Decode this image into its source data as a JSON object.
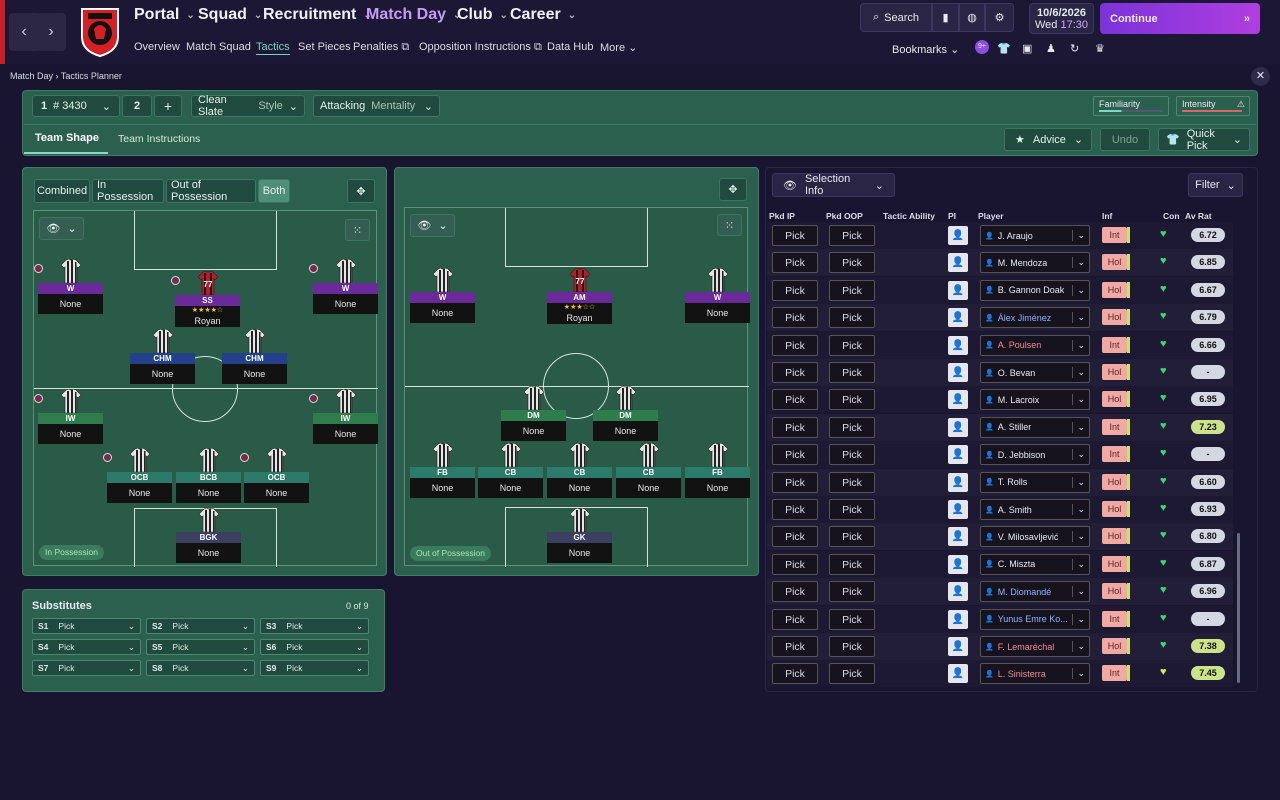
{
  "nav": {
    "main": [
      "Portal",
      "Squad",
      "Recruitment",
      "Match Day",
      "Club",
      "Career"
    ],
    "sub": [
      "Overview",
      "Match Squad",
      "Tactics",
      "Set Pieces",
      "Penalties",
      "Opposition Instructions",
      "Data Hub",
      "More"
    ],
    "search": "Search",
    "date": "10/6/2026",
    "day": "Wed",
    "time": "17:30",
    "continue": "Continue",
    "bookmarks": "Bookmarks",
    "badge": "9+"
  },
  "breadcrumb": {
    "a": "Match Day",
    "b": "Tactics Planner"
  },
  "tactics": {
    "slot1": "1",
    "formation": "# 3430",
    "slot2": "2",
    "style_name": "Clean Slate",
    "style_label": "Style",
    "mentality_name": "Attacking",
    "mentality_label": "Mentality",
    "familiarity": "Familiarity",
    "intensity": "Intensity",
    "tab_shape": "Team Shape",
    "tab_instr": "Team Instructions",
    "advice": "Advice",
    "undo": "Undo",
    "quick_pick": "Quick Pick",
    "view_btns": [
      "Combined",
      "In Possession",
      "Out of Possession",
      "Both"
    ],
    "in_pos": "In Possession",
    "out_pos": "Out of Possession"
  },
  "ip_slots": [
    {
      "pos": "W",
      "name": "None",
      "c": "purple"
    },
    {
      "pos": "SS",
      "name": "Royan",
      "c": "purple",
      "num": "77",
      "stars": "★★★★☆"
    },
    {
      "pos": "W",
      "name": "None",
      "c": "purple"
    },
    {
      "pos": "CHM",
      "name": "None",
      "c": "blue"
    },
    {
      "pos": "CHM",
      "name": "None",
      "c": "blue"
    },
    {
      "pos": "IW",
      "name": "None",
      "c": "green"
    },
    {
      "pos": "IW",
      "name": "None",
      "c": "green"
    },
    {
      "pos": "OCB",
      "name": "None",
      "c": "teal"
    },
    {
      "pos": "BCB",
      "name": "None",
      "c": "teal"
    },
    {
      "pos": "OCB",
      "name": "None",
      "c": "teal"
    },
    {
      "pos": "BGK",
      "name": "None",
      "c": "grey"
    }
  ],
  "op_slots": [
    {
      "pos": "W",
      "name": "None",
      "c": "purple"
    },
    {
      "pos": "AM",
      "name": "Royan",
      "c": "purple",
      "num": "77",
      "stars": "★★★☆☆"
    },
    {
      "pos": "W",
      "name": "None",
      "c": "purple"
    },
    {
      "pos": "DM",
      "name": "None",
      "c": "green"
    },
    {
      "pos": "DM",
      "name": "None",
      "c": "green"
    },
    {
      "pos": "FB",
      "name": "None",
      "c": "teal"
    },
    {
      "pos": "CB",
      "name": "None",
      "c": "teal"
    },
    {
      "pos": "CB",
      "name": "None",
      "c": "teal"
    },
    {
      "pos": "CB",
      "name": "None",
      "c": "teal"
    },
    {
      "pos": "FB",
      "name": "None",
      "c": "teal"
    },
    {
      "pos": "GK",
      "name": "None",
      "c": "grey"
    }
  ],
  "subs": {
    "title": "Substitutes",
    "count": "0 of 9",
    "items": [
      {
        "s": "S1",
        "v": "Pick"
      },
      {
        "s": "S2",
        "v": "Pick"
      },
      {
        "s": "S3",
        "v": "Pick"
      },
      {
        "s": "S4",
        "v": "Pick"
      },
      {
        "s": "S5",
        "v": "Pick"
      },
      {
        "s": "S6",
        "v": "Pick"
      },
      {
        "s": "S7",
        "v": "Pick"
      },
      {
        "s": "S8",
        "v": "Pick"
      },
      {
        "s": "S9",
        "v": "Pick"
      }
    ]
  },
  "selection": {
    "info": "Selection Info",
    "filter": "Filter",
    "headers": [
      "Pkd IP",
      "Pkd OOP",
      "Tactic Ability",
      "PI",
      "Player",
      "Inf",
      "Con",
      "Av Rat"
    ],
    "pick": "Pick",
    "rows": [
      {
        "p": "J. Araujo",
        "inf": "Int",
        "rat": "6.72",
        "col": "#e8e8f0",
        "rc": "#d5d8e2"
      },
      {
        "p": "M. Mendoza",
        "inf": "Hol",
        "rat": "6.85",
        "col": "#e8e8f0",
        "rc": "#d5d8e2"
      },
      {
        "p": "B. Gannon Doak",
        "inf": "Hol",
        "rat": "6.67",
        "col": "#e8e8f0",
        "rc": "#d5d8e2"
      },
      {
        "p": "Álex Jiménez",
        "inf": "Hol",
        "rat": "6.79",
        "col": "#8fb4ff",
        "rc": "#d5d8e2"
      },
      {
        "p": "A. Poulsen",
        "inf": "Int",
        "rat": "6.66",
        "col": "#f08d94",
        "rc": "#d5d8e2"
      },
      {
        "p": "O. Bevan",
        "inf": "Hol",
        "rat": "-",
        "col": "#e8e8f0",
        "rc": "#d5d8e2"
      },
      {
        "p": "M. Lacroix",
        "inf": "Hol",
        "rat": "6.95",
        "col": "#e8e8f0",
        "rc": "#d5d8e2"
      },
      {
        "p": "A. Stiller",
        "inf": "Int",
        "rat": "7.23",
        "col": "#e8e8f0",
        "rc": "#cde38a"
      },
      {
        "p": "D. Jebbison",
        "inf": "Int",
        "rat": "-",
        "col": "#e8e8f0",
        "rc": "#d5d8e2"
      },
      {
        "p": "T. Rolls",
        "inf": "Hol",
        "rat": "6.60",
        "col": "#e8e8f0",
        "rc": "#d5d8e2"
      },
      {
        "p": "A. Smith",
        "inf": "Hol",
        "rat": "6.93",
        "col": "#e8e8f0",
        "rc": "#d5d8e2"
      },
      {
        "p": "V. Milosavljević",
        "inf": "Hol",
        "rat": "6.80",
        "col": "#e8e8f0",
        "rc": "#d5d8e2"
      },
      {
        "p": "C. Miszta",
        "inf": "Hol",
        "rat": "6.87",
        "col": "#e8e8f0",
        "rc": "#d5d8e2"
      },
      {
        "p": "M. Diomandé",
        "inf": "Hol",
        "rat": "6.96",
        "col": "#8fb4ff",
        "rc": "#d5d8e2"
      },
      {
        "p": "Yunus Emre Ko...",
        "inf": "Int",
        "rat": "-",
        "col": "#8fb4ff",
        "rc": "#d5d8e2"
      },
      {
        "p": "F. Lemaréchal",
        "inf": "Hol",
        "rat": "7.38",
        "col": "#f08d94",
        "rc": "#cde38a"
      },
      {
        "p": "L. Sinisterra",
        "inf": "Int",
        "rat": "7.45",
        "col": "#f08d94",
        "rc": "#cde38a"
      }
    ]
  }
}
